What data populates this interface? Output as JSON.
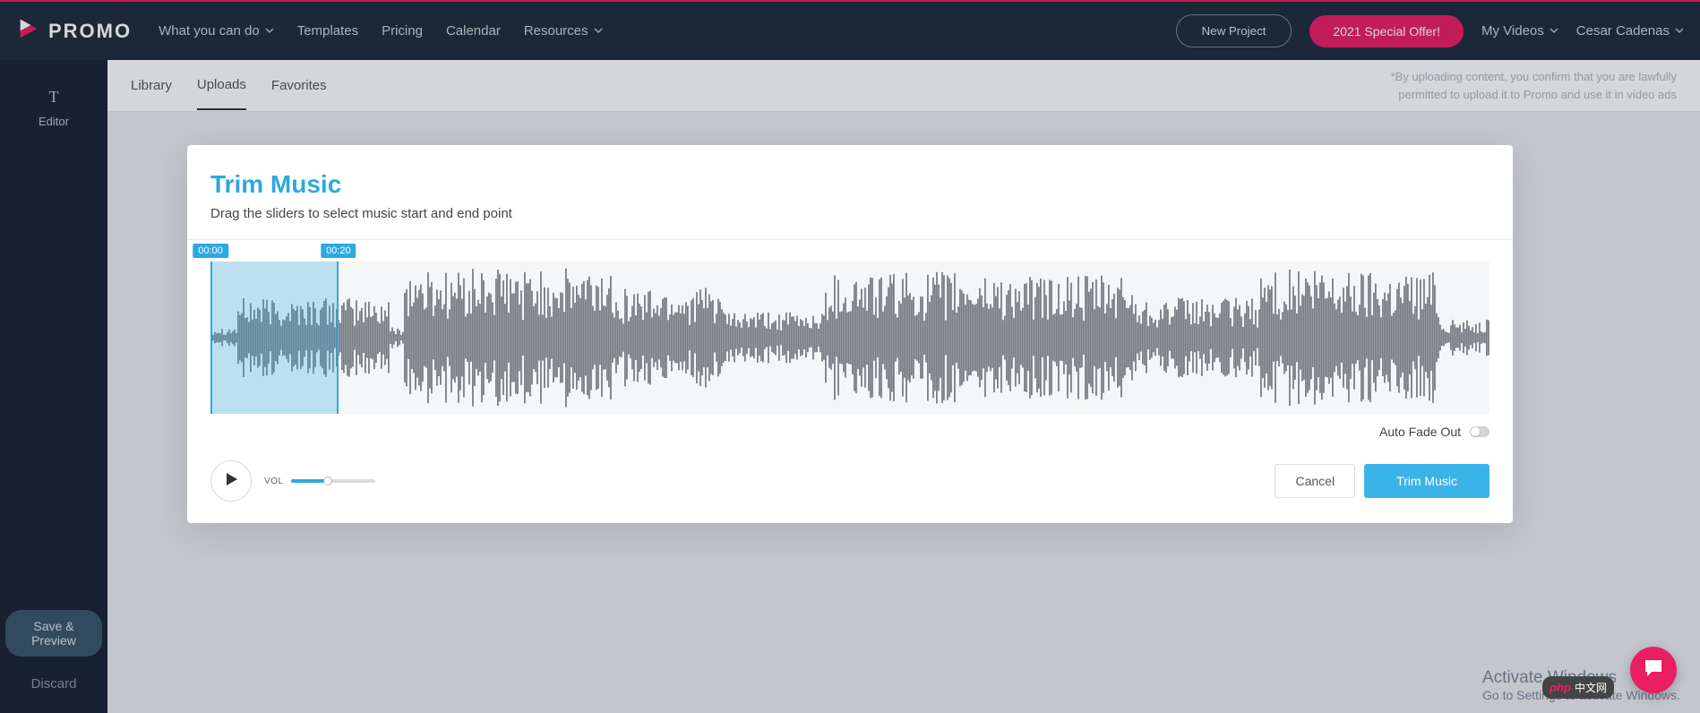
{
  "brand": {
    "name": "PROMO"
  },
  "nav": {
    "items": [
      {
        "label": "What you can do",
        "chevron": true
      },
      {
        "label": "Templates",
        "chevron": false
      },
      {
        "label": "Pricing",
        "chevron": false
      },
      {
        "label": "Calendar",
        "chevron": false
      },
      {
        "label": "Resources",
        "chevron": true
      }
    ]
  },
  "topbar": {
    "new_project": "New Project",
    "special_offer": "2021 Special Offer!",
    "my_videos": "My Videos",
    "user_name": "Cesar Cadenas"
  },
  "sidebar": {
    "editor_label": "Editor",
    "save_preview": "Save & Preview",
    "discard": "Discard"
  },
  "tabs": {
    "library": "Library",
    "uploads": "Uploads",
    "favorites": "Favorites"
  },
  "upload_note": "*By uploading content, you confirm that you are lawfully permitted to upload it to Promo and use it in video ads",
  "modal": {
    "title": "Trim Music",
    "subtitle": "Drag the sliders to select music start and end point",
    "time_start": "00:00",
    "time_end": "00:20",
    "selection_start_pct": 0,
    "selection_end_pct": 10,
    "auto_fade_out_label": "Auto Fade Out",
    "auto_fade_out_on": false,
    "volume_label": "VOL",
    "volume_pct": 44,
    "cancel": "Cancel",
    "trim": "Trim Music"
  },
  "activate": {
    "title": "Activate Windows",
    "sub": "Go to Settings to activate Windows."
  },
  "php_badge": {
    "php": "php",
    "cn": "中文网"
  }
}
